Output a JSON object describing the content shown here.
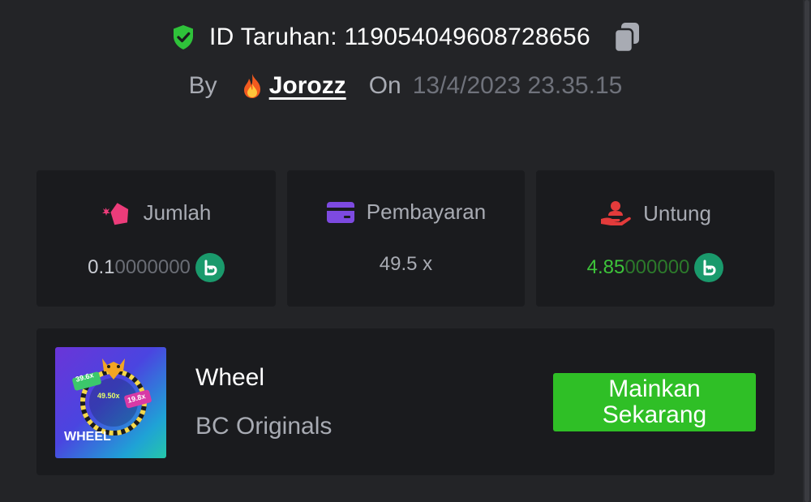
{
  "header": {
    "bet_id_label": "ID Taruhan: 119054049608728656",
    "by_label": "By",
    "username": "Jorozz",
    "on_label": "On",
    "date": "13/4/2023 23.35.15"
  },
  "stats": [
    {
      "label": "Jumlah",
      "value_bright": "0.1",
      "value_dim": "0000000",
      "icon": "bet-amount-icon",
      "color": "#ec3c7a"
    },
    {
      "label": "Pembayaran",
      "value": "49.5 x",
      "icon": "card-icon",
      "color": "#7d4ae0"
    },
    {
      "label": "Untung",
      "value_bright": "4.85",
      "value_dim": "000000",
      "icon": "profit-hand-icon",
      "color": "#e33b3b"
    }
  ],
  "coin_symbol": "b",
  "game": {
    "name": "Wheel",
    "provider": "BC Originals",
    "thumb_title": "WHEEL",
    "thumb_mult_left": "39.6x",
    "thumb_mult_center": "49.50x",
    "thumb_mult_right": "19.8x",
    "play_label": "Mainkan\nSekarang"
  },
  "colors": {
    "background": "#232427",
    "card": "#1a1b1e",
    "accent_green": "#2fbf26",
    "profit_green": "#3dc43a",
    "muted": "#a8abb3"
  }
}
